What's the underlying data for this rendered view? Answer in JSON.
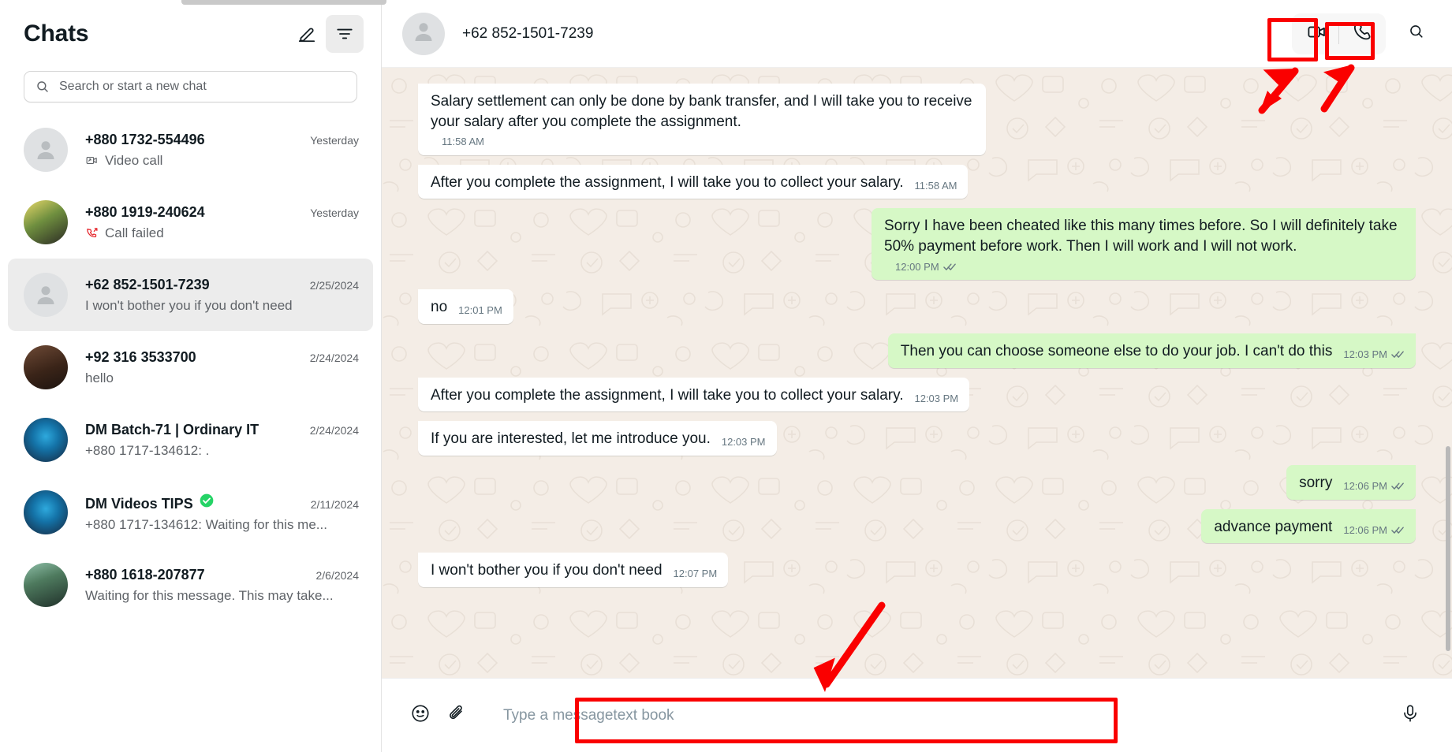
{
  "sidebar": {
    "title": "Chats",
    "compose_icon": "compose-new-chat-icon",
    "filter_icon": "filter-chats-icon",
    "search": {
      "placeholder": "Search or start a new chat",
      "icon": "search-icon"
    },
    "chats": [
      {
        "name": "+880 1732-554496",
        "time": "Yesterday",
        "preview": "Video call",
        "preview_icon": "video-call-icon",
        "avatar": "placeholder",
        "selected": false
      },
      {
        "name": "+880 1919-240624",
        "time": "Yesterday",
        "preview": "Call failed",
        "preview_icon": "call-failed-icon",
        "avatar": "photo-a",
        "selected": false
      },
      {
        "name": "+62 852-1501-7239",
        "time": "2/25/2024",
        "preview": "I won't bother you if you don't need",
        "preview_icon": "",
        "avatar": "placeholder",
        "selected": true
      },
      {
        "name": "+92 316 3533700",
        "time": "2/24/2024",
        "preview": "hello",
        "preview_icon": "",
        "avatar": "photo-b",
        "selected": false
      },
      {
        "name": "DM Batch-71 | Ordinary IT",
        "time": "2/24/2024",
        "preview": "+880 1717-134612: .",
        "preview_icon": "",
        "avatar": "photo-c",
        "selected": false
      },
      {
        "name": "DM Videos TIPS",
        "verified": true,
        "time": "2/11/2024",
        "preview": "+880 1717-134612: Waiting for this me...",
        "preview_icon": "",
        "avatar": "photo-c",
        "selected": false
      },
      {
        "name": "+880 1618-207877",
        "time": "2/6/2024",
        "preview": "Waiting for this message. This may take...",
        "preview_icon": "",
        "avatar": "photo-d",
        "selected": false
      }
    ]
  },
  "conversation": {
    "contact_name": "+62 852-1501-7239",
    "avatar_icon": "contact-placeholder-icon",
    "actions": {
      "video_call": "video-call-icon",
      "voice_call": "voice-call-icon",
      "search": "search-icon"
    },
    "messages": [
      {
        "direction": "in",
        "text": "Salary settlement can only be done by bank transfer, and I will take you to receive your salary after you complete the assignment.",
        "time": "11:58 AM",
        "status": ""
      },
      {
        "direction": "in",
        "text": "After you complete the assignment, I will take you to collect your salary.",
        "time": "11:58 AM",
        "status": ""
      },
      {
        "direction": "out",
        "text": "Sorry I have been cheated like this many times before. So I will definitely take 50% payment before work. Then I will work and I will not work.",
        "time": "12:00 PM",
        "status": "delivered"
      },
      {
        "direction": "in",
        "text": "no",
        "time": "12:01 PM",
        "status": ""
      },
      {
        "direction": "out",
        "text": "Then you can choose someone else to do your job. I can't do this",
        "time": "12:03 PM",
        "status": "delivered"
      },
      {
        "direction": "in",
        "text": "After you complete the assignment, I will take you to collect your salary.",
        "time": "12:03 PM",
        "status": ""
      },
      {
        "direction": "in",
        "text": "If you are interested, let me introduce you.",
        "time": "12:03 PM",
        "status": ""
      },
      {
        "direction": "out",
        "text": "sorry",
        "time": "12:06 PM",
        "status": "delivered"
      },
      {
        "direction": "out",
        "text": "advance payment",
        "time": "12:06 PM",
        "status": "delivered"
      },
      {
        "direction": "in",
        "text": "I won't bother you if you don't need",
        "time": "12:07 PM",
        "status": ""
      }
    ],
    "compose": {
      "emoji_icon": "emoji-icon",
      "attach_icon": "attachment-clip-icon",
      "placeholder": "Type a message",
      "annotation_text": "text book",
      "mic_icon": "microphone-icon"
    }
  },
  "annotations": {
    "accent_color": "#fa0000",
    "boxes": [
      "video-call-button",
      "voice-call-button",
      "message-input"
    ],
    "arrows": 3
  }
}
